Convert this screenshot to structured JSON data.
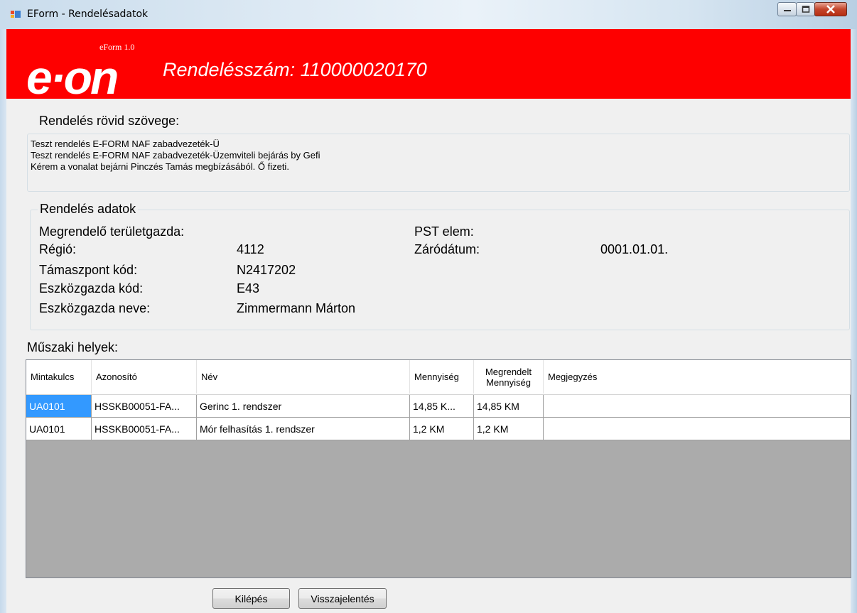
{
  "window": {
    "title": "EForm - Rendelésadatok",
    "controls": [
      "minimize-icon",
      "maximize-icon",
      "close-icon"
    ]
  },
  "header": {
    "logo_text": "e·on",
    "eform_version": "eForm 1.0",
    "order_number_text": "Rendelésszám: 110000020170",
    "background_color": "#fe0000"
  },
  "short_text": {
    "label": "Rendelés rövid szövege:",
    "lines": [
      "Teszt rendelés E-FORM NAF zabadvezeték-Ü",
      "Teszt rendelés E-FORM NAF zabadvezeték-Üzemviteli bejárás by Gefi",
      "Kérem a vonalat bejárni Pinczés Tamás megbízásából. Ő fizeti."
    ]
  },
  "order_data": {
    "legend": "Rendelés adatok",
    "left_fields": [
      {
        "label": "Megrendelő területgazda:",
        "value": ""
      },
      {
        "label": "Régió:",
        "value": "4112"
      },
      {
        "label": "Támaszpont kód:",
        "value": "N2417202"
      },
      {
        "label": "Eszközgazda kód:",
        "value": "E43"
      },
      {
        "label": "Eszközgazda neve:",
        "value": "Zimmermann Márton"
      }
    ],
    "right_fields": [
      {
        "label": "PST elem:",
        "value": ""
      },
      {
        "label": "Záródátum:",
        "value": "0001.01.01."
      }
    ]
  },
  "technical_places": {
    "label": "Műszaki helyek:",
    "columns": [
      "Mintakulcs",
      "Azonosító",
      "Név",
      "Mennyiség",
      "Megrendelt",
      "Mennyiség",
      "Megjegyzés"
    ],
    "rows": [
      [
        "UA0101",
        "HSSKB00051-FA...",
        "Gerinc 1. rendszer",
        "14,85 K...",
        "14,85 KM",
        ""
      ],
      [
        "UA0101",
        "HSSKB00051-FA...",
        "Mór felhasítás 1. rendszer",
        "1,2 KM",
        "1,2 KM",
        ""
      ]
    ],
    "selected_color": "#3399ff"
  },
  "buttons": {
    "exit": "Kilépés",
    "report": "Visszajelentés"
  }
}
